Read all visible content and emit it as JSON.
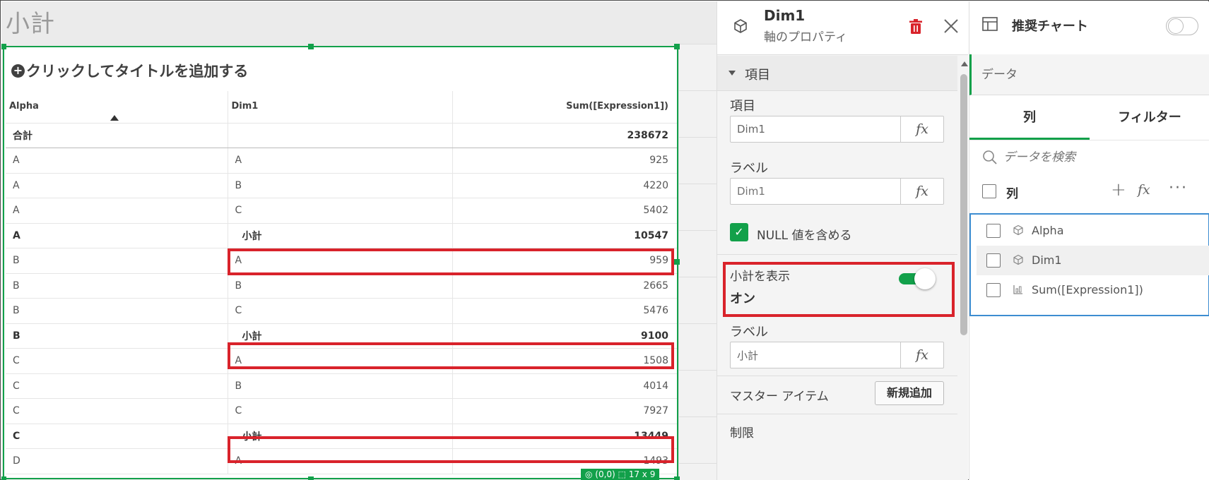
{
  "sheet": {
    "title": "小計"
  },
  "object": {
    "title": "クリックしてタイトルを追加する",
    "status": "◎ (0,0) ⬚ 17 x 9"
  },
  "pivot": {
    "headers": [
      "Alpha",
      "Dim1",
      "Sum([Expression1])"
    ],
    "total_row": {
      "label": "合計",
      "value": "238672"
    },
    "rows": [
      {
        "alpha": "A",
        "dim1": "A",
        "value": "925",
        "subtotal": false
      },
      {
        "alpha": "A",
        "dim1": "B",
        "value": "4220",
        "subtotal": false
      },
      {
        "alpha": "A",
        "dim1": "C",
        "value": "5402",
        "subtotal": false
      },
      {
        "alpha": "A",
        "dim1": "小計",
        "value": "10547",
        "subtotal": true
      },
      {
        "alpha": "B",
        "dim1": "A",
        "value": "959",
        "subtotal": false
      },
      {
        "alpha": "B",
        "dim1": "B",
        "value": "2665",
        "subtotal": false
      },
      {
        "alpha": "B",
        "dim1": "C",
        "value": "5476",
        "subtotal": false
      },
      {
        "alpha": "B",
        "dim1": "小計",
        "value": "9100",
        "subtotal": true
      },
      {
        "alpha": "C",
        "dim1": "A",
        "value": "1508",
        "subtotal": false
      },
      {
        "alpha": "C",
        "dim1": "B",
        "value": "4014",
        "subtotal": false
      },
      {
        "alpha": "C",
        "dim1": "C",
        "value": "7927",
        "subtotal": false
      },
      {
        "alpha": "C",
        "dim1": "小計",
        "value": "13449",
        "subtotal": true
      },
      {
        "alpha": "D",
        "dim1": "A",
        "value": "1493",
        "subtotal": false
      }
    ]
  },
  "props": {
    "title": "Dim1",
    "subtitle": "軸のプロパティ",
    "section": "項目",
    "field_label": "項目",
    "field_value": "Dim1",
    "label_label": "ラベル",
    "label_placeholder": "Dim1",
    "fx": "fx",
    "null_label": "NULL 値を含める",
    "subtotal_label": "小計を表示",
    "subtotal_state": "オン",
    "sub_label_label": "ラベル",
    "sub_label_value": "小計",
    "master_label": "マスター アイテム",
    "master_button": "新規追加",
    "limit_label": "制限"
  },
  "data_panel": {
    "title": "推奨チャート",
    "data_tab": "データ",
    "tabs": [
      "列",
      "フィルター"
    ],
    "search_placeholder": "データを検索",
    "columns_header": "列",
    "fields": [
      "Alpha",
      "Dim1",
      "Sum([Expression1])"
    ]
  },
  "colors": {
    "accent": "#12a04a",
    "highlight": "#d9232b",
    "selection": "#3d8dd1"
  },
  "icons": [
    "plus-circle-icon",
    "sort-up-icon",
    "cube-icon",
    "trash-icon",
    "close-icon",
    "caret-down-icon",
    "check-icon",
    "table-icon",
    "search-icon",
    "add-icon",
    "fx-icon",
    "more-icon",
    "measure-icon"
  ]
}
